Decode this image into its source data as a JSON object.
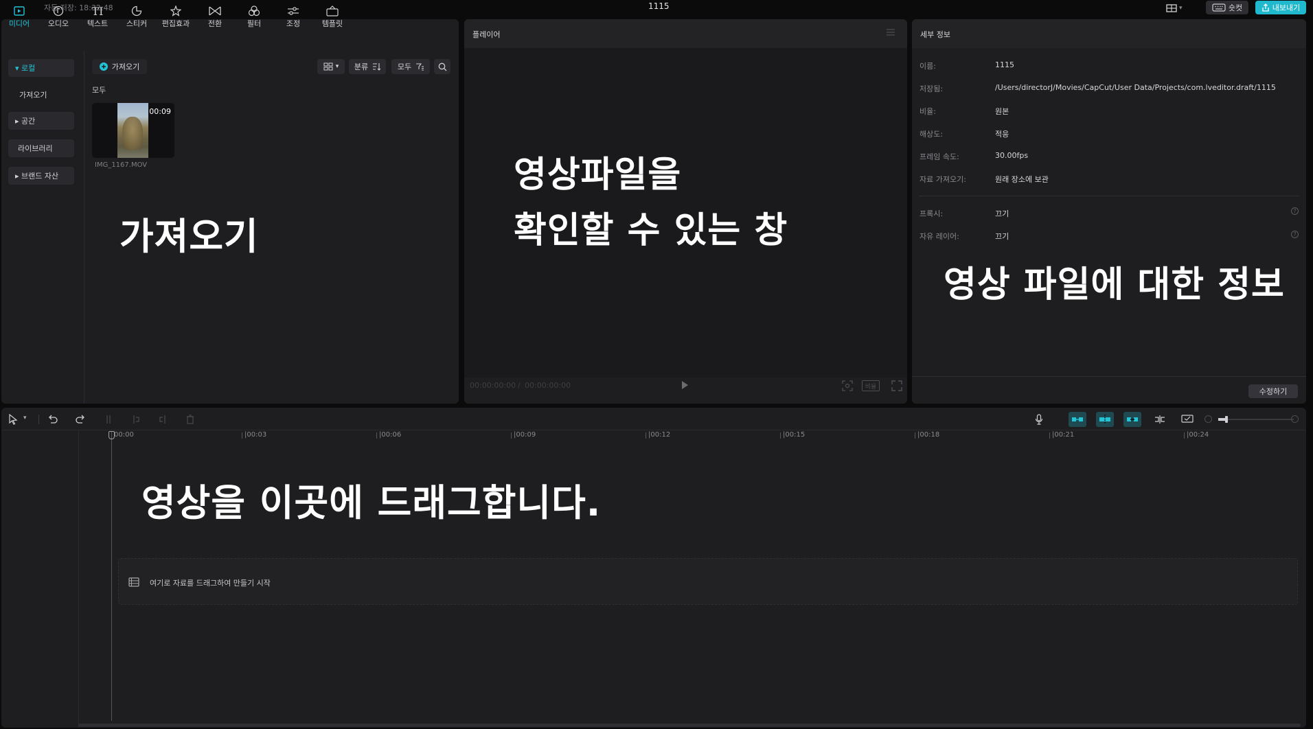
{
  "window": {
    "autosave": "자동 저장: 18:32:48",
    "project_title": "1115",
    "shortcut_label": "숏컷",
    "export_label": "내보내기"
  },
  "toolbar": {
    "items": [
      {
        "label": "미디어",
        "icon": "media-icon"
      },
      {
        "label": "오디오",
        "icon": "audio-icon"
      },
      {
        "label": "텍스트",
        "icon": "text-icon"
      },
      {
        "label": "스티커",
        "icon": "sticker-icon"
      },
      {
        "label": "편집효과",
        "icon": "effects-icon"
      },
      {
        "label": "전환",
        "icon": "transition-icon"
      },
      {
        "label": "필터",
        "icon": "filter-icon"
      },
      {
        "label": "조정",
        "icon": "adjust-icon"
      },
      {
        "label": "템플릿",
        "icon": "template-icon"
      }
    ]
  },
  "sidebar": {
    "items": [
      {
        "label": "▾ 로컬"
      },
      {
        "label": "가져오기"
      },
      {
        "label": "▸ 공간"
      },
      {
        "label": "라이브러리"
      },
      {
        "label": "▸ 브랜드 자산"
      }
    ]
  },
  "media": {
    "import_label": "가져오기",
    "sort_label": "분류",
    "filter_label": "모두",
    "section_label": "모두",
    "clip": {
      "duration": "00:09",
      "filename": "IMG_1167.MOV"
    }
  },
  "player": {
    "title": "플레이어",
    "current_time": "00:00:00:00",
    "total_time": "00:00:00:00",
    "ratio_label": "비율"
  },
  "details": {
    "title": "세부 정보",
    "rows": [
      {
        "key": "이름:",
        "value": "1115"
      },
      {
        "key": "저장됨:",
        "value": "/Users/directorJ/Movies/CapCut/User Data/Projects/com.lveditor.draft/1115"
      },
      {
        "key": "비율:",
        "value": "원본"
      },
      {
        "key": "해상도:",
        "value": "적응"
      },
      {
        "key": "프레임 속도:",
        "value": "30.00fps"
      },
      {
        "key": "자료 가져오기:",
        "value": "원래 장소에 보관"
      }
    ],
    "rows2": [
      {
        "key": "프록시:",
        "value": "끄기"
      },
      {
        "key": "자유 레이어:",
        "value": "끄기"
      }
    ],
    "modify_label": "수정하기"
  },
  "timeline": {
    "ticks": [
      "00:00",
      "|00:03",
      "|00:06",
      "|00:09",
      "|00:12",
      "|00:15",
      "|00:18",
      "|00:21",
      "|00:24"
    ],
    "drop_hint": "여기로 자료를 드래그하여 만들기 시작"
  },
  "annotations": {
    "import": "가져오기",
    "player_line1": "영상파일을",
    "player_line2": "확인할 수 있는 창",
    "details": "영상 파일에 대한 정보",
    "timeline": "영상을 이곳에 드래그합니다."
  },
  "colors": {
    "accent": "#22c4d6",
    "panel": "#1e1e20",
    "background": "#0b0b0c"
  }
}
